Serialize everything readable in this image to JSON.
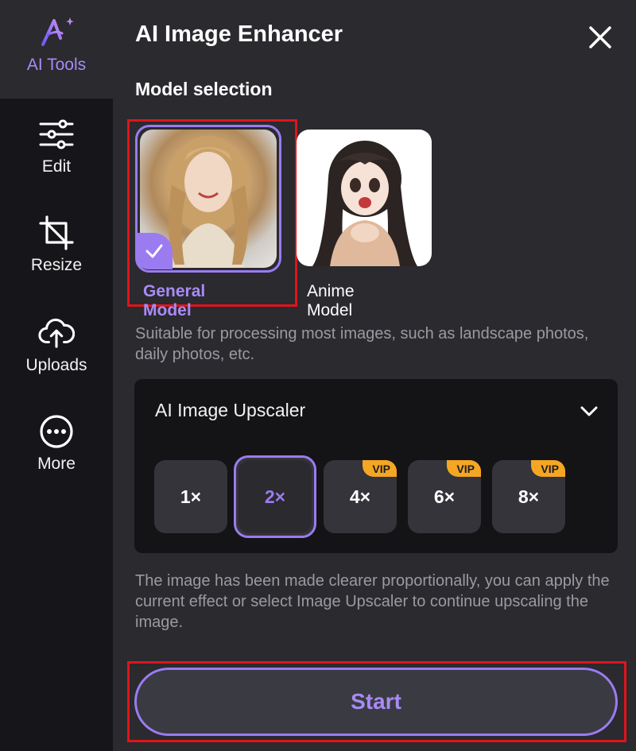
{
  "sidebar": {
    "items": [
      {
        "label": "AI Tools",
        "icon": "ai-logo-icon"
      },
      {
        "label": "Edit",
        "icon": "sliders-icon"
      },
      {
        "label": "Resize",
        "icon": "crop-icon"
      },
      {
        "label": "Uploads",
        "icon": "cloud-upload-icon"
      },
      {
        "label": "More",
        "icon": "more-icon"
      }
    ]
  },
  "panel": {
    "title": "AI Image Enhancer",
    "section_title": "Model selection",
    "models": [
      {
        "label": "General Model",
        "selected": true
      },
      {
        "label": "Anime Model",
        "selected": false
      }
    ],
    "model_description": "Suitable for processing most images, such as landscape photos, daily photos, etc.",
    "upscaler": {
      "title": "AI Image Upscaler",
      "options": [
        {
          "label": "1×",
          "vip": false,
          "selected": false
        },
        {
          "label": "2×",
          "vip": false,
          "selected": true
        },
        {
          "label": "4×",
          "vip": true,
          "selected": false
        },
        {
          "label": "6×",
          "vip": true,
          "selected": false
        },
        {
          "label": "8×",
          "vip": true,
          "selected": false
        }
      ],
      "vip_label": "VIP"
    },
    "result_description": "The image has been made clearer proportionally, you can apply the current effect or select Image Upscaler to continue upscaling the image.",
    "start_label": "Start"
  },
  "colors": {
    "accent": "#9b7bf0",
    "vip": "#f5a623",
    "highlight": "#e0141b",
    "panel_bg": "#2a2a2f",
    "rail_bg": "#16161a"
  }
}
